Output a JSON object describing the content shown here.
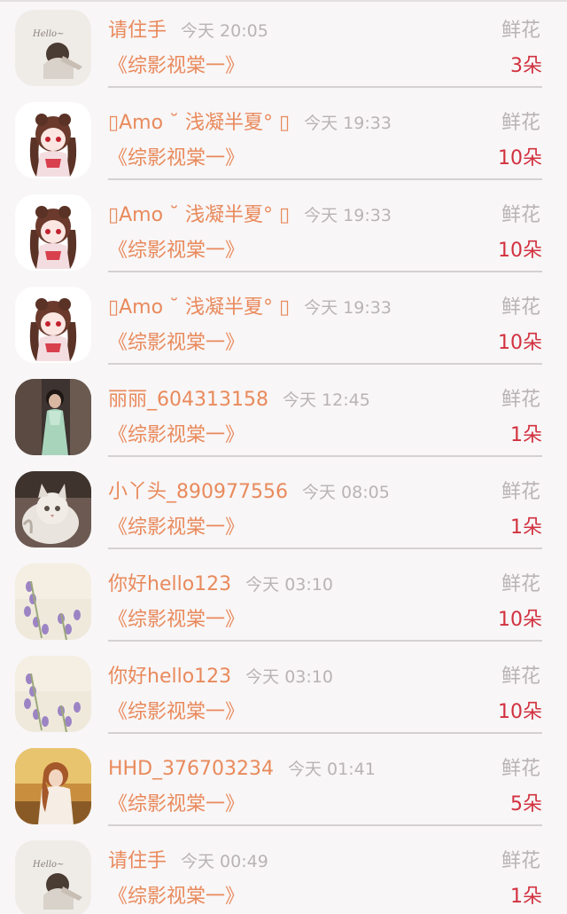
{
  "records": [
    {
      "name": "请住手",
      "time": "今天 20:05",
      "gift": "鲜花",
      "book": "《综影视棠一》",
      "count": "3朵",
      "avatar": "hello-girl-avatar"
    },
    {
      "name": "▯Amo ˘ 浅凝半夏° ▯",
      "time": "今天 19:33",
      "gift": "鲜花",
      "book": "《综影视棠一》",
      "count": "10朵",
      "avatar": "anime-girl-avatar"
    },
    {
      "name": "▯Amo ˘ 浅凝半夏° ▯",
      "time": "今天 19:33",
      "gift": "鲜花",
      "book": "《综影视棠一》",
      "count": "10朵",
      "avatar": "anime-girl-avatar"
    },
    {
      "name": "▯Amo ˘ 浅凝半夏° ▯",
      "time": "今天 19:33",
      "gift": "鲜花",
      "book": "《综影视棠一》",
      "count": "10朵",
      "avatar": "anime-girl-avatar"
    },
    {
      "name": "丽丽_604313158",
      "time": "今天 12:45",
      "gift": "鲜花",
      "book": "《综影视棠一》",
      "count": "1朵",
      "avatar": "woman-dress-avatar"
    },
    {
      "name": "小丫头_890977556",
      "time": "今天 08:05",
      "gift": "鲜花",
      "book": "《综影视棠一》",
      "count": "1朵",
      "avatar": "kitten-avatar"
    },
    {
      "name": "你好hello123",
      "time": "今天 03:10",
      "gift": "鲜花",
      "book": "《综影视棠一》",
      "count": "10朵",
      "avatar": "lavender-avatar"
    },
    {
      "name": "你好hello123",
      "time": "今天 03:10",
      "gift": "鲜花",
      "book": "《综影视棠一》",
      "count": "10朵",
      "avatar": "lavender-avatar"
    },
    {
      "name": "HHD_376703234",
      "time": "今天 01:41",
      "gift": "鲜花",
      "book": "《综影视棠一》",
      "count": "5朵",
      "avatar": "sunset-girl-avatar"
    },
    {
      "name": "请住手",
      "time": "今天 00:49",
      "gift": "鲜花",
      "book": "《综影视棠一》",
      "count": "1朵",
      "avatar": "hello-girl-avatar"
    }
  ]
}
